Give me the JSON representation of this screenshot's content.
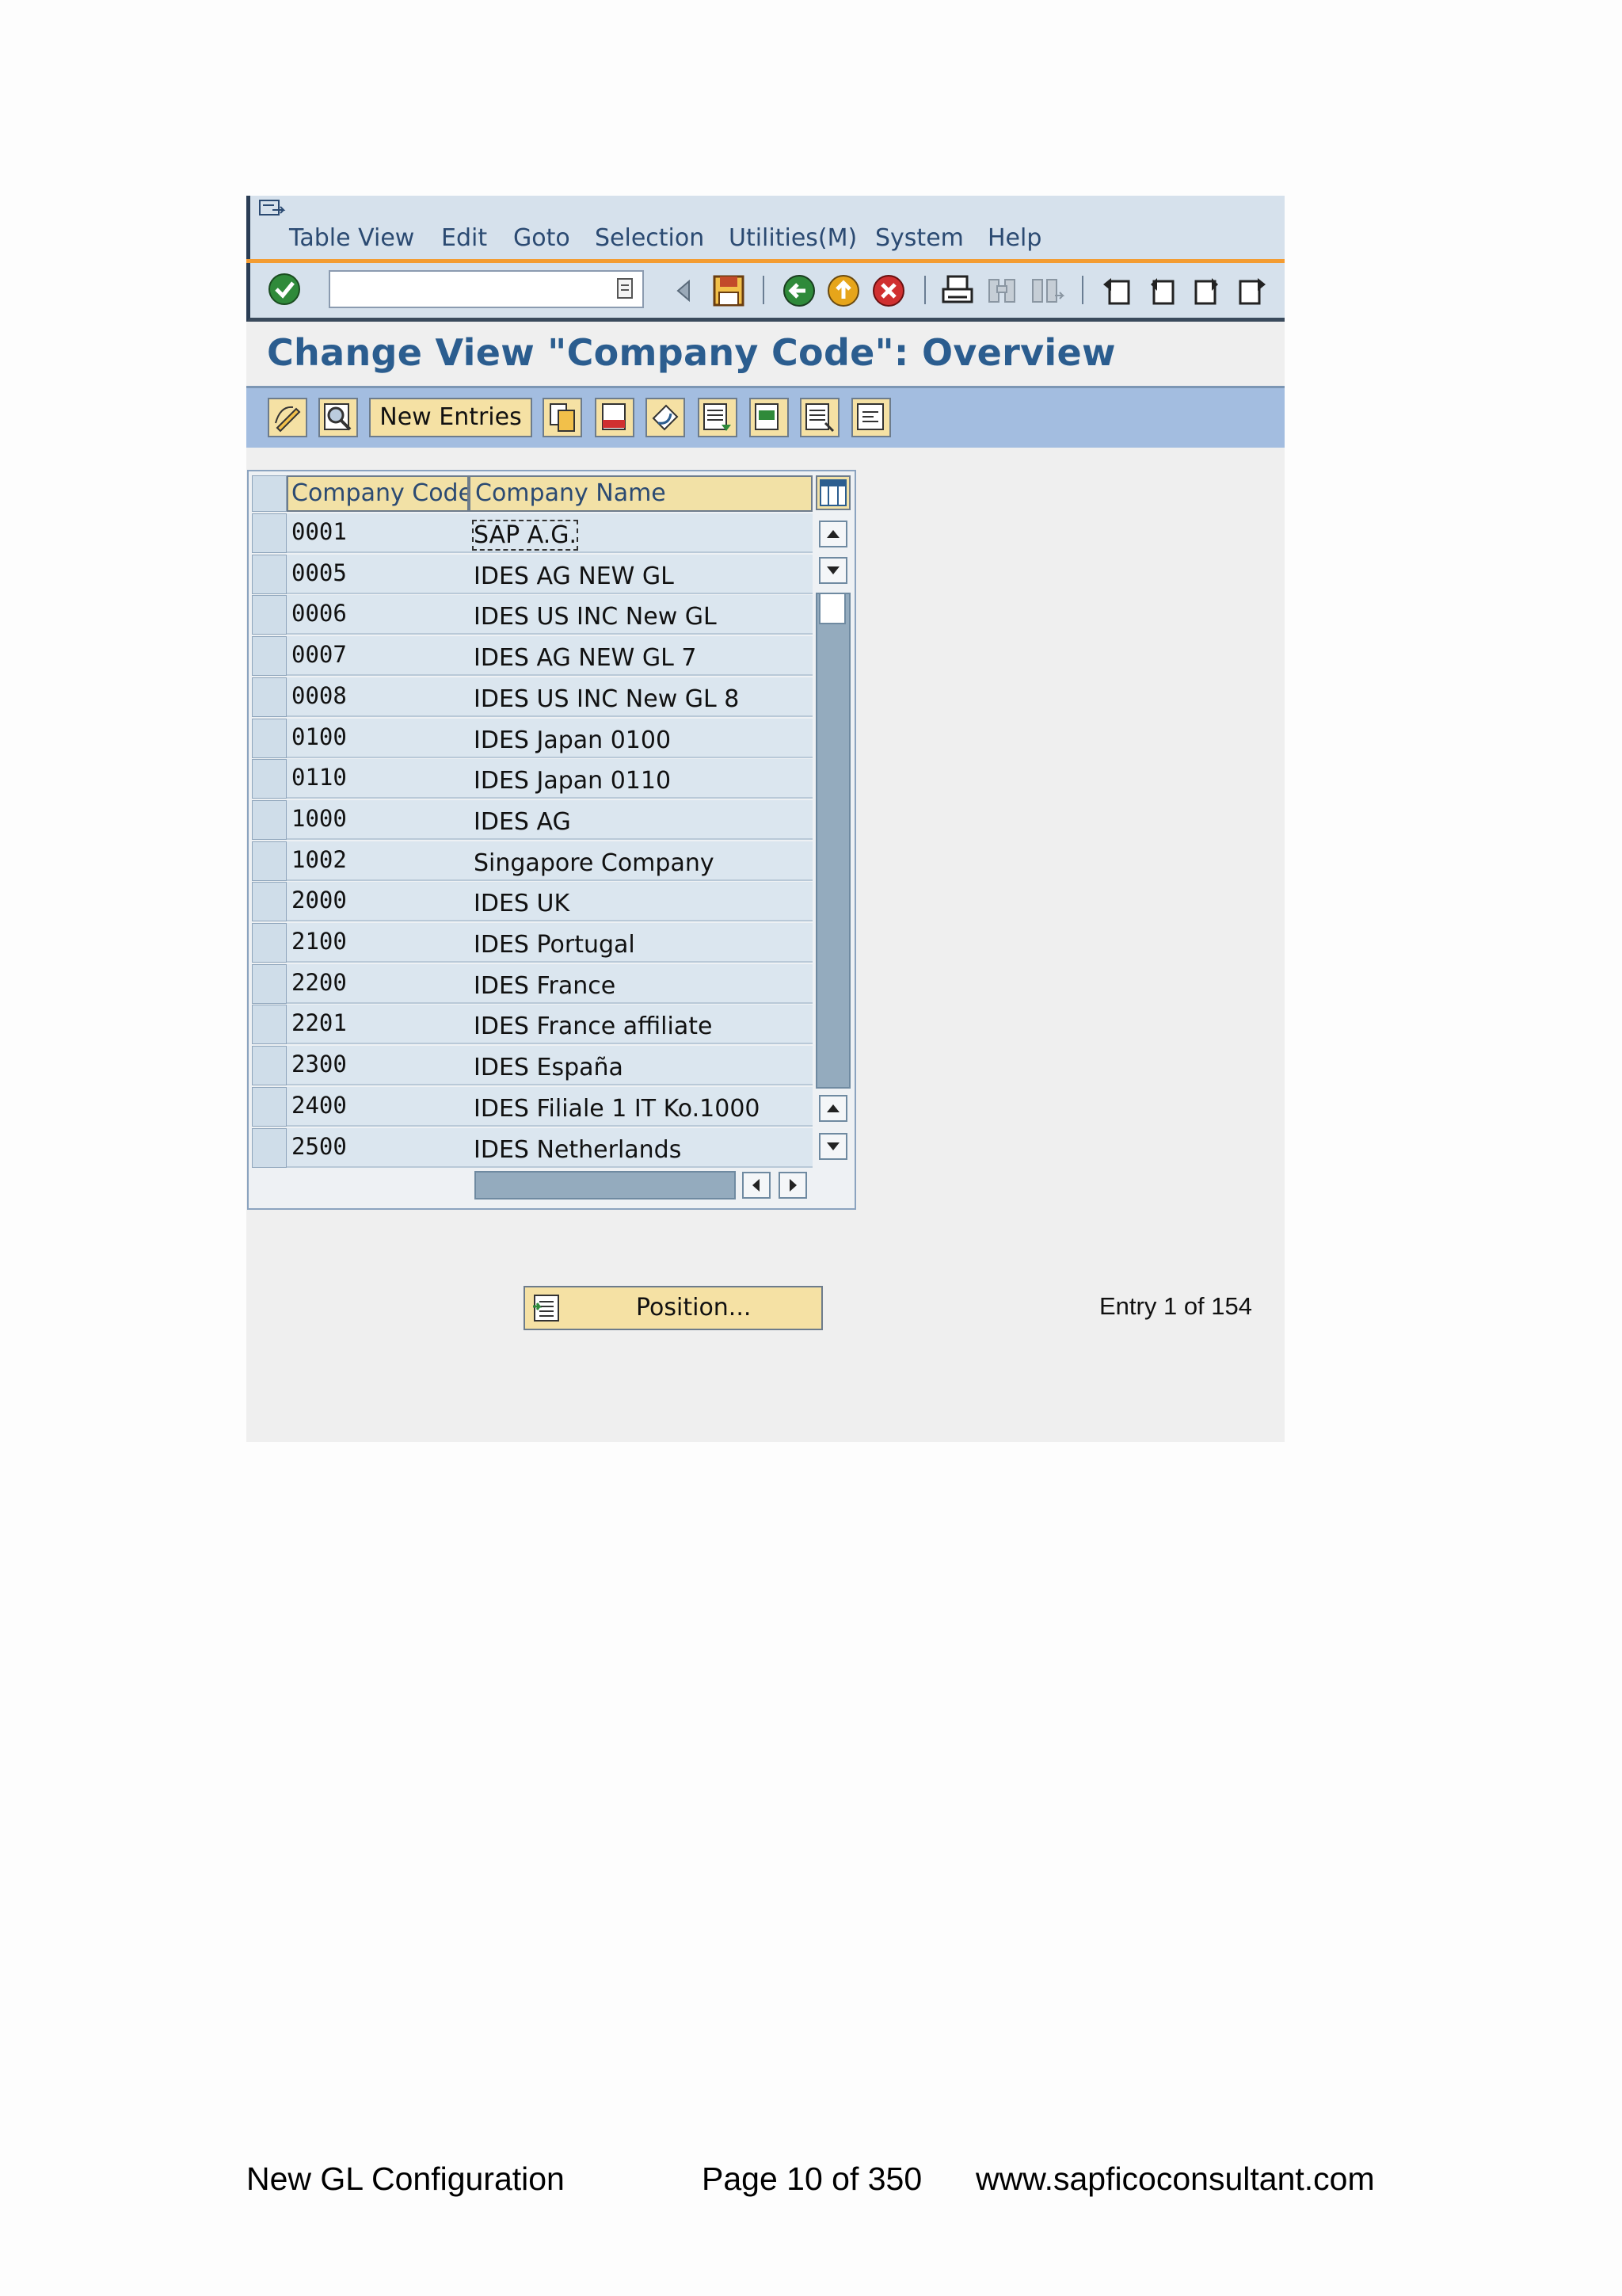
{
  "menu": [
    "Table View",
    "Edit",
    "Goto",
    "Selection",
    "Utilities(M)",
    "System",
    "Help"
  ],
  "title": "Change View \"Company Code\": Overview",
  "app_toolbar": {
    "new_entries": "New Entries"
  },
  "table": {
    "headers": {
      "code": "Company Code",
      "name": "Company Name"
    },
    "rows": [
      {
        "code": "0001",
        "name": "SAP A.G."
      },
      {
        "code": "0005",
        "name": "IDES AG NEW GL"
      },
      {
        "code": "0006",
        "name": "IDES US INC New GL"
      },
      {
        "code": "0007",
        "name": "IDES AG NEW GL 7"
      },
      {
        "code": "0008",
        "name": "IDES US INC New GL 8"
      },
      {
        "code": "0100",
        "name": "IDES Japan 0100"
      },
      {
        "code": "0110",
        "name": "IDES Japan 0110"
      },
      {
        "code": "1000",
        "name": "IDES AG"
      },
      {
        "code": "1002",
        "name": "Singapore Company"
      },
      {
        "code": "2000",
        "name": "IDES UK"
      },
      {
        "code": "2100",
        "name": "IDES Portugal"
      },
      {
        "code": "2200",
        "name": "IDES France"
      },
      {
        "code": "2201",
        "name": "IDES France affiliate"
      },
      {
        "code": "2300",
        "name": "IDES España"
      },
      {
        "code": "2400",
        "name": "IDES Filiale 1 IT Ko.1000"
      },
      {
        "code": "2500",
        "name": "IDES Netherlands"
      }
    ]
  },
  "position_button": "Position...",
  "entry_info": "Entry 1 of 154",
  "footer": {
    "left": "New GL Configuration",
    "center": "Page 10 of 350",
    "right": "www.sapficoconsultant.com"
  },
  "colors": {
    "title": "#2b5d8f",
    "menu_text": "#2b4a72",
    "accent_line": "#f39c32",
    "app_toolbar_bg": "#a3bde0",
    "button_bg": "#f5e1a4"
  },
  "icons": {
    "toolbar": [
      "enter-icon",
      "command-dropdown-icon",
      "back-arrow-icon",
      "save-icon",
      "back-icon",
      "exit-icon",
      "cancel-icon",
      "print-icon",
      "find-icon",
      "find-next-icon",
      "first-page-icon",
      "previous-page-icon",
      "next-page-icon",
      "last-page-icon"
    ],
    "app_toolbar": [
      "display-change-icon",
      "details-icon",
      "copy-as-icon",
      "delete-icon",
      "undo-change-icon",
      "select-all-icon",
      "select-block-icon",
      "deselect-all-icon",
      "print-field-icon"
    ]
  }
}
